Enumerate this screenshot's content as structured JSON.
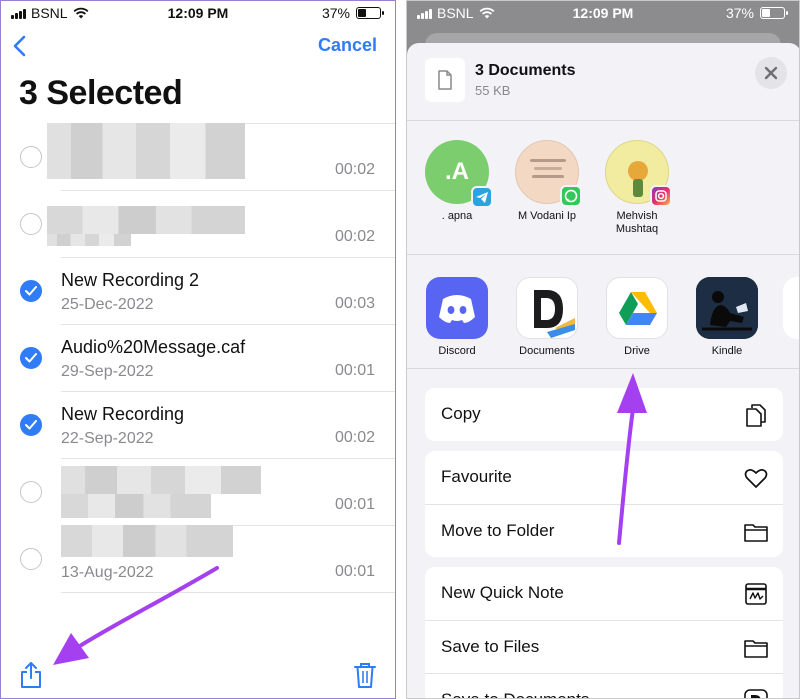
{
  "left": {
    "status": {
      "carrier": "BSNL",
      "time": "12:09 PM",
      "battery": "37%"
    },
    "nav": {
      "cancel_label": "Cancel"
    },
    "title": "3 Selected",
    "recordings": [
      {
        "name": "",
        "date": "",
        "duration": "00:02",
        "selected": false,
        "redacted": true
      },
      {
        "name": "",
        "date": "",
        "duration": "00:02",
        "selected": false,
        "redacted": true
      },
      {
        "name": "New Recording 2",
        "date": "25-Dec-2022",
        "duration": "00:03",
        "selected": true,
        "redacted": false
      },
      {
        "name": "Audio%20Message.caf",
        "date": "29-Sep-2022",
        "duration": "00:01",
        "selected": true,
        "redacted": false
      },
      {
        "name": "New Recording",
        "date": "22-Sep-2022",
        "duration": "00:02",
        "selected": true,
        "redacted": false
      },
      {
        "name": "",
        "date": "",
        "duration": "00:01",
        "selected": false,
        "redacted": true
      },
      {
        "name": "",
        "date": "13-Aug-2022",
        "duration": "00:01",
        "selected": false,
        "redacted": true
      }
    ]
  },
  "right": {
    "status": {
      "carrier": "BSNL",
      "time": "12:09 PM",
      "battery": "37%"
    },
    "sheet": {
      "title": "3 Documents",
      "subtitle": "55 KB"
    },
    "contacts": [
      {
        "name": ". apna",
        "initial": ".A",
        "badge": "telegram-icon",
        "color": "#7ccd6e"
      },
      {
        "name": "M Vodani Ip",
        "initial": "",
        "badge": "whatsapp-icon",
        "color": "#f3d9c4"
      },
      {
        "name": "Mehvish Mushtaq",
        "initial": "",
        "badge": "instagram-icon",
        "color": "#f1ec9f"
      }
    ],
    "apps": [
      {
        "name": "Discord",
        "icon": "discord-icon"
      },
      {
        "name": "Documents",
        "icon": "documents-app-icon"
      },
      {
        "name": "Drive",
        "icon": "google-drive-icon"
      },
      {
        "name": "Kindle",
        "icon": "kindle-icon"
      }
    ],
    "actions": {
      "copy": "Copy",
      "favourite": "Favourite",
      "move_to_folder": "Move to Folder",
      "new_quick_note": "New Quick Note",
      "save_to_files": "Save to Files",
      "save_to_documents": "Save to Documents"
    }
  },
  "colors": {
    "accent": "#2f7cf6",
    "annotation_arrow": "#a440f0"
  }
}
